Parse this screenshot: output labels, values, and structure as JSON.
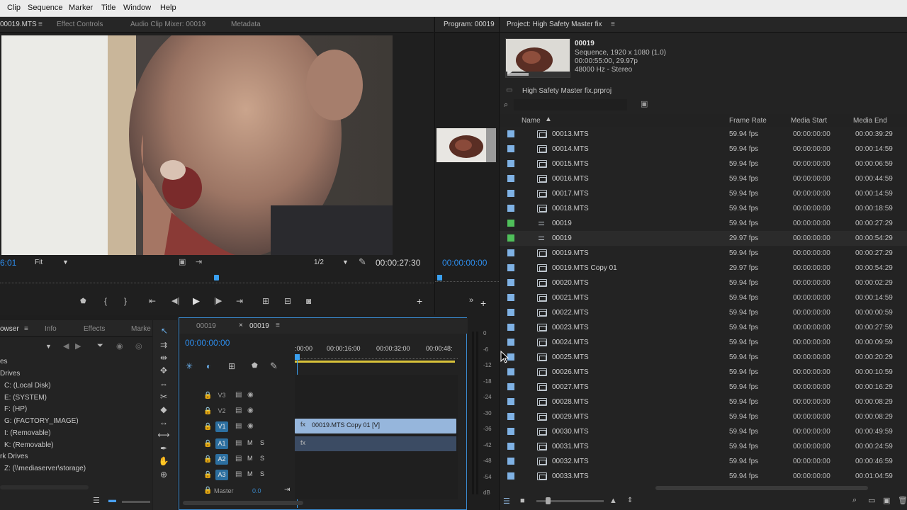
{
  "menu": [
    "Clip",
    "Sequence",
    "Marker",
    "Title",
    "Window",
    "Help"
  ],
  "source_panel": {
    "tabs": [
      "00019.MTS",
      "Effect Controls",
      "Audio Clip Mixer: 00019",
      "Metadata"
    ],
    "timecode_left": "6:01",
    "fit_label": "Fit",
    "resolution": "1/2",
    "duration": "00:00:27:30"
  },
  "program_panel": {
    "title": "Program: 00019",
    "timecode": "00:00:00:00"
  },
  "project_panel": {
    "title": "Project: High Safety Master fix",
    "preview": {
      "name": "00019",
      "line1": "Sequence, 1920 x 1080 (1.0)",
      "line2": "00:00:55:00, 29.97p",
      "line3": "48000 Hz - Stereo"
    },
    "project_file": "High Safety Master fix.prproj",
    "columns": [
      "Name",
      "Frame Rate",
      "Media Start",
      "Media End"
    ],
    "rows": [
      {
        "name": "00013.MTS",
        "fps": "59.94 fps",
        "start": "00:00:00:00",
        "end": "00:00:39:29",
        "kind": "clip",
        "color": "#7fb2e5"
      },
      {
        "name": "00014.MTS",
        "fps": "59.94 fps",
        "start": "00:00:00:00",
        "end": "00:00:14:59",
        "kind": "clip",
        "color": "#7fb2e5"
      },
      {
        "name": "00015.MTS",
        "fps": "59.94 fps",
        "start": "00:00:00:00",
        "end": "00:00:06:59",
        "kind": "clip",
        "color": "#7fb2e5"
      },
      {
        "name": "00016.MTS",
        "fps": "59.94 fps",
        "start": "00:00:00:00",
        "end": "00:00:44:59",
        "kind": "clip",
        "color": "#7fb2e5"
      },
      {
        "name": "00017.MTS",
        "fps": "59.94 fps",
        "start": "00:00:00:00",
        "end": "00:00:14:59",
        "kind": "clip",
        "color": "#7fb2e5"
      },
      {
        "name": "00018.MTS",
        "fps": "59.94 fps",
        "start": "00:00:00:00",
        "end": "00:00:18:59",
        "kind": "clip",
        "color": "#7fb2e5"
      },
      {
        "name": "00019",
        "fps": "59.94 fps",
        "start": "00:00:00:00",
        "end": "00:00:27:29",
        "kind": "seq",
        "color": "#4fbf5a"
      },
      {
        "name": "00019",
        "fps": "29.97 fps",
        "start": "00:00:00:00",
        "end": "00:00:54:29",
        "kind": "seq",
        "color": "#4fbf5a"
      },
      {
        "name": "00019.MTS",
        "fps": "59.94 fps",
        "start": "00:00:00:00",
        "end": "00:00:27:29",
        "kind": "clip",
        "color": "#7fb2e5"
      },
      {
        "name": "00019.MTS Copy 01",
        "fps": "29.97 fps",
        "start": "00:00:00:00",
        "end": "00:00:54:29",
        "kind": "clip",
        "color": "#7fb2e5"
      },
      {
        "name": "00020.MTS",
        "fps": "59.94 fps",
        "start": "00:00:00:00",
        "end": "00:00:02:29",
        "kind": "clip",
        "color": "#7fb2e5"
      },
      {
        "name": "00021.MTS",
        "fps": "59.94 fps",
        "start": "00:00:00:00",
        "end": "00:00:14:59",
        "kind": "clip",
        "color": "#7fb2e5"
      },
      {
        "name": "00022.MTS",
        "fps": "59.94 fps",
        "start": "00:00:00:00",
        "end": "00:00:00:59",
        "kind": "clip",
        "color": "#7fb2e5"
      },
      {
        "name": "00023.MTS",
        "fps": "59.94 fps",
        "start": "00:00:00:00",
        "end": "00:00:27:59",
        "kind": "clip",
        "color": "#7fb2e5"
      },
      {
        "name": "00024.MTS",
        "fps": "59.94 fps",
        "start": "00:00:00:00",
        "end": "00:00:09:59",
        "kind": "clip",
        "color": "#7fb2e5"
      },
      {
        "name": "00025.MTS",
        "fps": "59.94 fps",
        "start": "00:00:00:00",
        "end": "00:00:20:29",
        "kind": "clip",
        "color": "#7fb2e5"
      },
      {
        "name": "00026.MTS",
        "fps": "59.94 fps",
        "start": "00:00:00:00",
        "end": "00:00:10:59",
        "kind": "clip",
        "color": "#7fb2e5"
      },
      {
        "name": "00027.MTS",
        "fps": "59.94 fps",
        "start": "00:00:00:00",
        "end": "00:00:16:29",
        "kind": "clip",
        "color": "#7fb2e5"
      },
      {
        "name": "00028.MTS",
        "fps": "59.94 fps",
        "start": "00:00:00:00",
        "end": "00:00:08:29",
        "kind": "clip",
        "color": "#7fb2e5"
      },
      {
        "name": "00029.MTS",
        "fps": "59.94 fps",
        "start": "00:00:00:00",
        "end": "00:00:08:29",
        "kind": "clip",
        "color": "#7fb2e5"
      },
      {
        "name": "00030.MTS",
        "fps": "59.94 fps",
        "start": "00:00:00:00",
        "end": "00:00:49:59",
        "kind": "clip",
        "color": "#7fb2e5"
      },
      {
        "name": "00031.MTS",
        "fps": "59.94 fps",
        "start": "00:00:00:00",
        "end": "00:00:24:59",
        "kind": "clip",
        "color": "#7fb2e5"
      },
      {
        "name": "00032.MTS",
        "fps": "59.94 fps",
        "start": "00:00:00:00",
        "end": "00:00:46:59",
        "kind": "clip",
        "color": "#7fb2e5"
      },
      {
        "name": "00033.MTS",
        "fps": "59.94 fps",
        "start": "00:00:00:00",
        "end": "00:01:04:59",
        "kind": "clip",
        "color": "#7fb2e5"
      }
    ]
  },
  "media_browser": {
    "tabs": [
      "owser",
      "Info",
      "Effects",
      "Marke"
    ],
    "items": [
      "es",
      "Drives",
      "C: (Local Disk)",
      "E: (SYSTEM)",
      "F: (HP)",
      "G: (FACTORY_IMAGE)",
      "I: (Removable)",
      "K: (Removable)",
      "rk Drives",
      "Z: (\\\\mediaserver\\storage)"
    ]
  },
  "timeline": {
    "tabs": [
      "00019",
      "00019"
    ],
    "timecode": "00:00:00:00",
    "ruler": [
      ":00:00",
      "00:00:16:00",
      "00:00:32:00",
      "00:00:48:"
    ],
    "video_tracks": [
      "V3",
      "V2",
      "V1"
    ],
    "audio_tracks": [
      "A1",
      "A2",
      "A3"
    ],
    "master_label": "Master",
    "master_value": "0.0",
    "clip_label": "00019.MTS Copy 01 [V]",
    "mute_label": "M",
    "solo_label": "S"
  },
  "audio_meter": {
    "levels": [
      "0",
      "-6",
      "-12",
      "-18",
      "-24",
      "-30",
      "-36",
      "-42",
      "-48",
      "-54",
      "dB"
    ]
  }
}
